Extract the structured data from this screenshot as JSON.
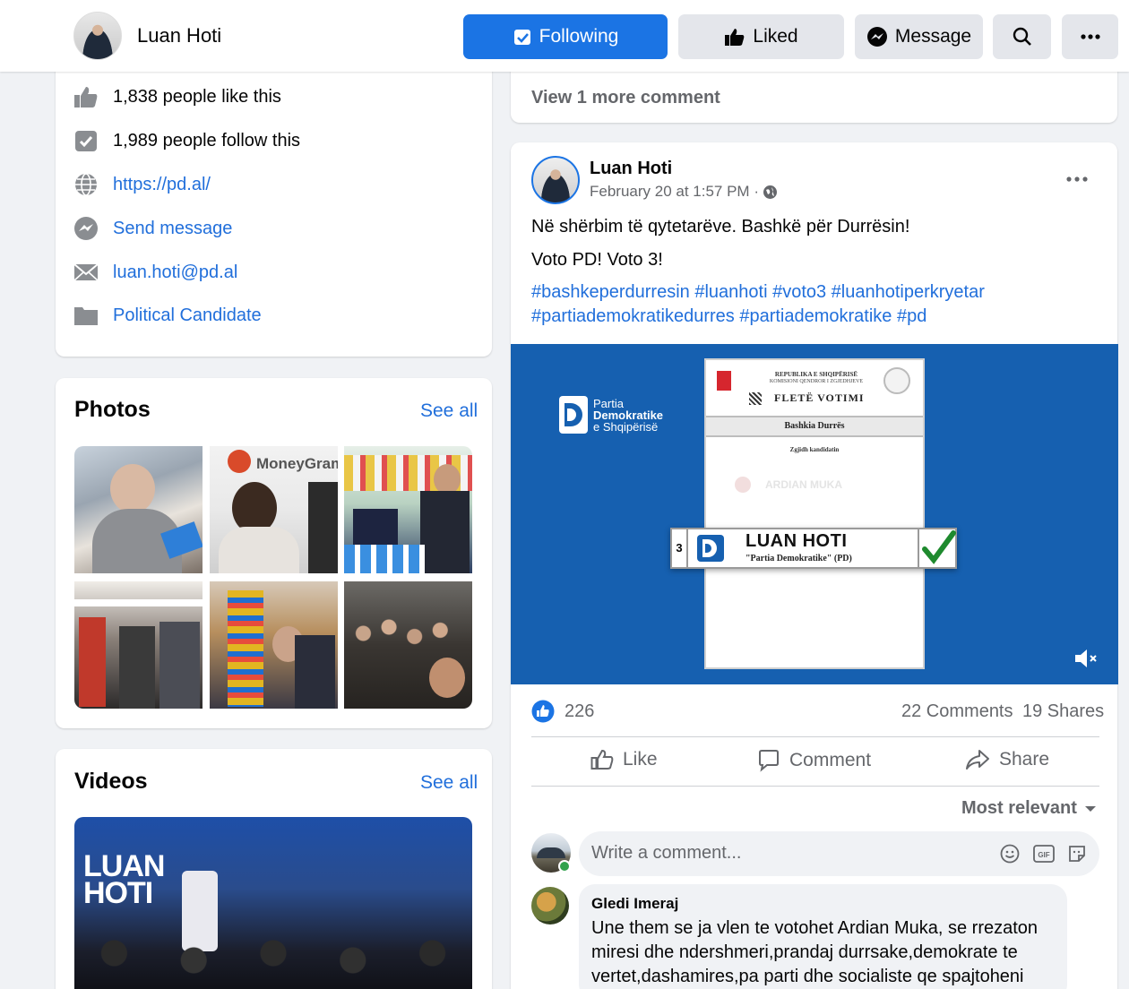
{
  "header": {
    "page_name": "Luan Hoti",
    "following_label": "Following",
    "liked_label": "Liked",
    "message_label": "Message"
  },
  "intro": {
    "likes": "1,838 people like this",
    "follows": "1,989 people follow this",
    "website": "https://pd.al/",
    "send_message": "Send message",
    "email": "luan.hoti@pd.al",
    "category": "Political Candidate"
  },
  "photos": {
    "title": "Photos",
    "see_all": "See all"
  },
  "videos": {
    "title": "Videos",
    "see_all": "See all"
  },
  "prev_post": {
    "view_more": "View 1 more comment"
  },
  "post": {
    "author": "Luan Hoti",
    "date": "February 20 at 1:57 PM ·",
    "line1": "Në shërbim të qytetarëve. Bashkë për Durrësin!",
    "line2": "Voto PD! Voto 3!",
    "hashtags_line1": "#bashkeperdurresin #luanhoti #voto3 #luanhotiperkryetar",
    "hashtags_line2": "#partiademokratikedurres #partiademokratike #pd",
    "reactions": "226",
    "comments": "22 Comments",
    "shares": "19 Shares",
    "like_label": "Like",
    "comment_label": "Comment",
    "share_label": "Share",
    "sort_label": "Most relevant",
    "comment_placeholder": "Write a comment..."
  },
  "media": {
    "party_line1": "Partia",
    "party_line2": "Demokratike",
    "party_line3": "e Shqipërisë",
    "ballot_header1": "REPUBLIKA E SHQIPËRISË",
    "ballot_header2": "KOMISIONI QENDROR I ZGJEDHJEVE",
    "ballot_title": "FLETË VOTIMI",
    "ballot_municipality": "Bashkia Durrës",
    "ballot_choose": "Zgjidh kandidatin",
    "ballot_faded_name": "ARDIAN MUKA",
    "candidate_number": "3",
    "candidate_name": "LUAN HOTI",
    "candidate_party": "\"Partia Demokratike\" (PD)"
  },
  "comment1": {
    "author": "Gledi Imeraj",
    "line1": "Une them se ja vlen te votohet Ardian Muka, se rrezaton",
    "line2": "miresi dhe ndershmeri,prandaj durrsake,demokrate te",
    "line3": "vertet,dashamires,pa parti dhe socialiste qe spajtoheni"
  },
  "colors": {
    "accent": "#1b74e4",
    "link": "#216fdb",
    "media_bg": "#1660b0"
  }
}
